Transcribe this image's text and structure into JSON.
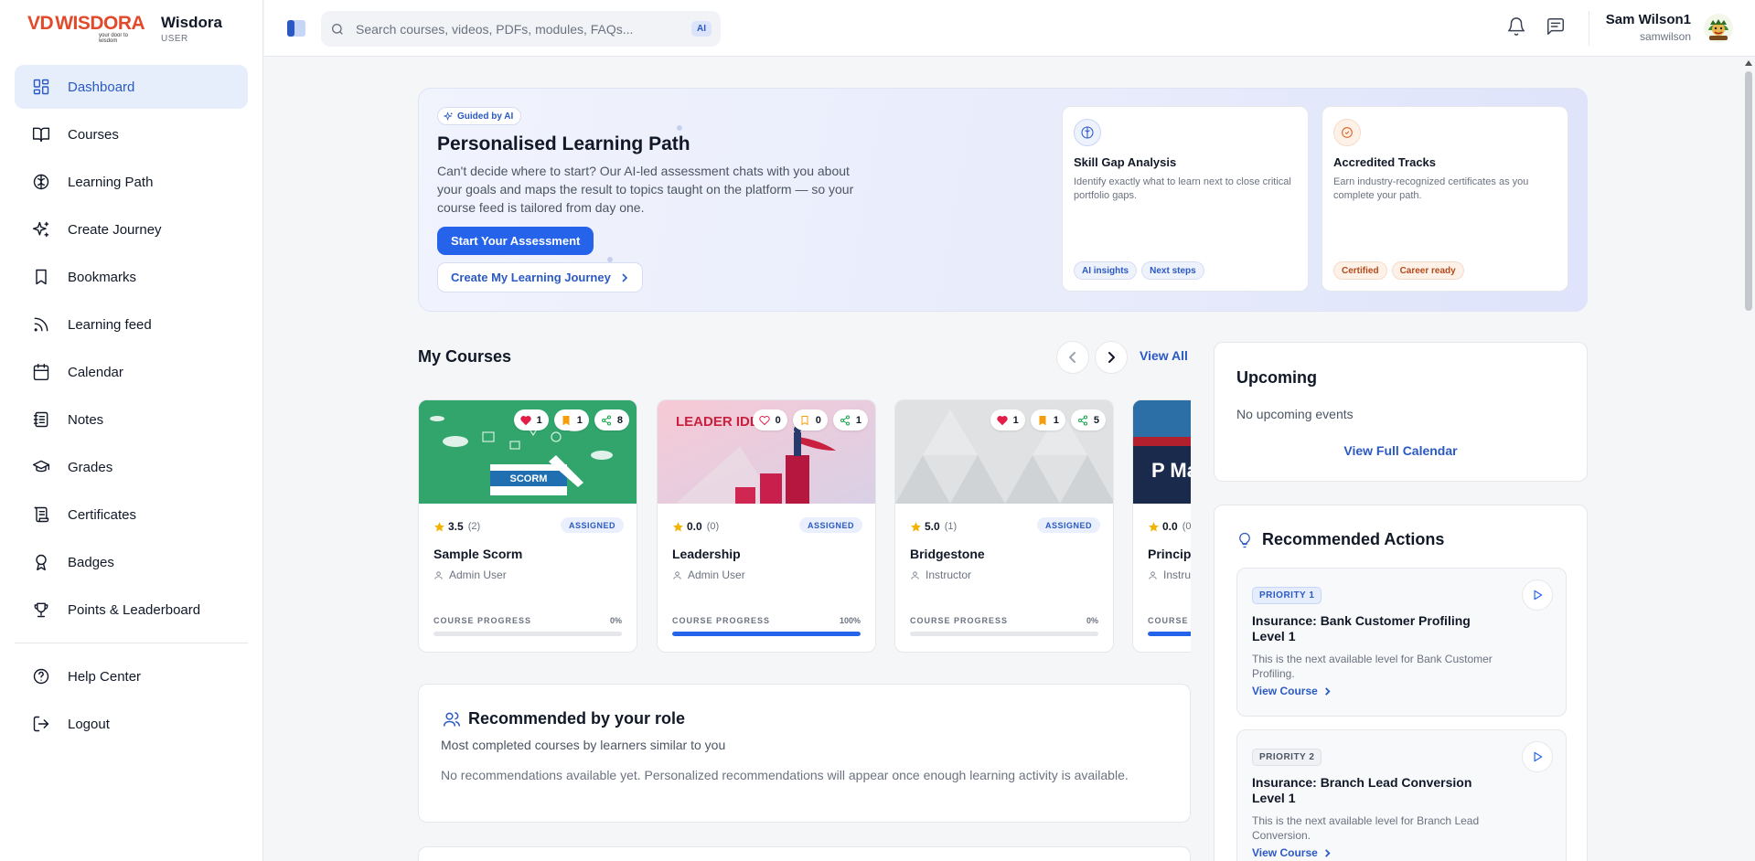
{
  "brand": {
    "logo_text": "WISDORA",
    "logo_tagline": "your door to wisdom",
    "name": "Wisdora",
    "role": "USER"
  },
  "sidebar": {
    "items": [
      {
        "label": "Dashboard",
        "icon": "grid-icon",
        "active": true
      },
      {
        "label": "Courses",
        "icon": "book-open-icon"
      },
      {
        "label": "Learning Path",
        "icon": "brain-icon"
      },
      {
        "label": "Create Journey",
        "icon": "sparkles-icon"
      },
      {
        "label": "Bookmarks",
        "icon": "bookmark-icon"
      },
      {
        "label": "Learning feed",
        "icon": "rss-icon"
      },
      {
        "label": "Calendar",
        "icon": "calendar-icon"
      },
      {
        "label": "Notes",
        "icon": "notebook-icon"
      },
      {
        "label": "Grades",
        "icon": "graduation-cap-icon"
      },
      {
        "label": "Certificates",
        "icon": "scroll-icon"
      },
      {
        "label": "Badges",
        "icon": "award-icon"
      },
      {
        "label": "Points & Leaderboard",
        "icon": "trophy-icon"
      }
    ],
    "bottom_items": [
      {
        "label": "Help Center",
        "icon": "help-circle-icon"
      },
      {
        "label": "Logout",
        "icon": "logout-icon"
      }
    ]
  },
  "topbar": {
    "search_placeholder": "Search courses, videos, PDFs, modules, FAQs...",
    "ai_chip": "AI",
    "user_name": "Sam Wilson1",
    "user_handle": "samwilson"
  },
  "hero": {
    "chip": "Guided by AI",
    "title": "Personalised Learning Path",
    "description": "Can't decide where to start? Our AI-led assessment chats with you about your goals and maps the result to topics taught on the platform — so your course feed is tailored from day one.",
    "primary_button": "Start Your Assessment",
    "secondary_button": "Create My Learning Journey",
    "features": [
      {
        "title": "Skill Gap Analysis",
        "description": "Identify exactly what to learn next to close critical portfolio gaps.",
        "tags": [
          "AI insights",
          "Next steps"
        ],
        "accent": "#2b59c3"
      },
      {
        "title": "Accredited Tracks",
        "description": "Earn industry-recognized certificates as you complete your path.",
        "tags": [
          "Certified",
          "Career ready"
        ],
        "accent": "#e0621f"
      }
    ]
  },
  "my_courses": {
    "title": "My Courses",
    "view_all": "View All",
    "progress_label": "COURSE PROGRESS",
    "badge": "ASSIGNED",
    "courses": [
      {
        "name": "Sample Scorm",
        "author": "Admin User",
        "rating": "3.5",
        "rating_count": "(2)",
        "likes": "1",
        "bookmarks": "1",
        "shares": "8",
        "progress": "0%",
        "progress_value": 0,
        "thumb_text": "SCORM"
      },
      {
        "name": "Leadership",
        "author": "Admin User",
        "rating": "0.0",
        "rating_count": "(0)",
        "likes": "0",
        "bookmarks": "0",
        "shares": "1",
        "progress": "100%",
        "progress_value": 100,
        "thumb_text": "LEADER IDEA"
      },
      {
        "name": "Bridgestone",
        "author": "Instructor",
        "rating": "5.0",
        "rating_count": "(1)",
        "likes": "1",
        "bookmarks": "1",
        "shares": "5",
        "progress": "0%",
        "progress_value": 0
      },
      {
        "name": "Princip",
        "author": "Instru",
        "rating": "0.0",
        "rating_count": "(0",
        "progress": "",
        "progress_value": 60,
        "thumb_text": "P Ma"
      }
    ]
  },
  "role_recs": {
    "title": "Recommended by your role",
    "subtitle": "Most completed courses by learners similar to you",
    "empty": "No recommendations available yet. Personalized recommendations will appear once enough learning activity is available."
  },
  "upcoming": {
    "title": "Upcoming",
    "empty": "No upcoming events",
    "link": "View Full Calendar"
  },
  "recommended_actions": {
    "title": "Recommended Actions",
    "link": "View Course",
    "items": [
      {
        "priority": "PRIORITY 1",
        "title": "Insurance: Bank Customer Profiling Level 1",
        "description": "This is the next available level for Bank Customer Profiling."
      },
      {
        "priority": "PRIORITY 2",
        "title": "Insurance: Branch Lead Conversion Level 1",
        "description": "This is the next available level for Branch Lead Conversion."
      }
    ]
  }
}
